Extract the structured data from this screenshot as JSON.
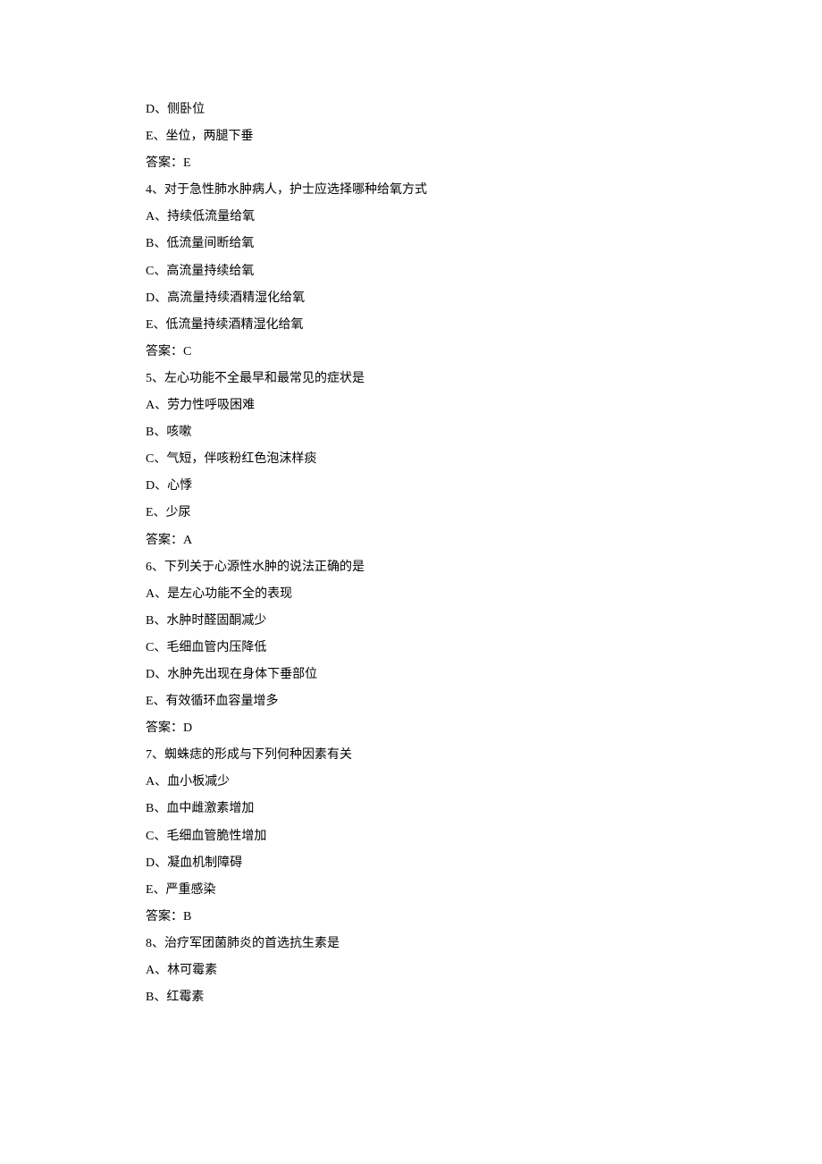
{
  "lines": [
    "D、侧卧位",
    "E、坐位，两腿下垂",
    "答案：E",
    "4、对于急性肺水肿病人，护士应选择哪种给氧方式",
    "A、持续低流量给氧",
    "B、低流量间断给氧",
    "C、高流量持续给氧",
    "D、高流量持续酒精湿化给氧",
    "E、低流量持续酒精湿化给氧",
    "答案：C",
    "5、左心功能不全最早和最常见的症状是",
    "A、劳力性呼吸困难",
    "B、咳嗽",
    "C、气短，伴咳粉红色泡沫样痰",
    "D、心悸",
    "E、少尿",
    "答案：A",
    "6、下列关于心源性水肿的说法正确的是",
    "A、是左心功能不全的表现",
    "B、水肿时醛固酮减少",
    "C、毛细血管内压降低",
    "D、水肿先出现在身体下垂部位",
    "E、有效循环血容量增多",
    "答案：D",
    "7、蜘蛛痣的形成与下列何种因素有关",
    "A、血小板减少",
    "B、血中雌激素增加",
    "C、毛细血管脆性增加",
    "D、凝血机制障碍",
    "E、严重感染",
    "答案：B",
    "8、治疗军团菌肺炎的首选抗生素是",
    "A、林可霉素",
    "B、红霉素"
  ]
}
